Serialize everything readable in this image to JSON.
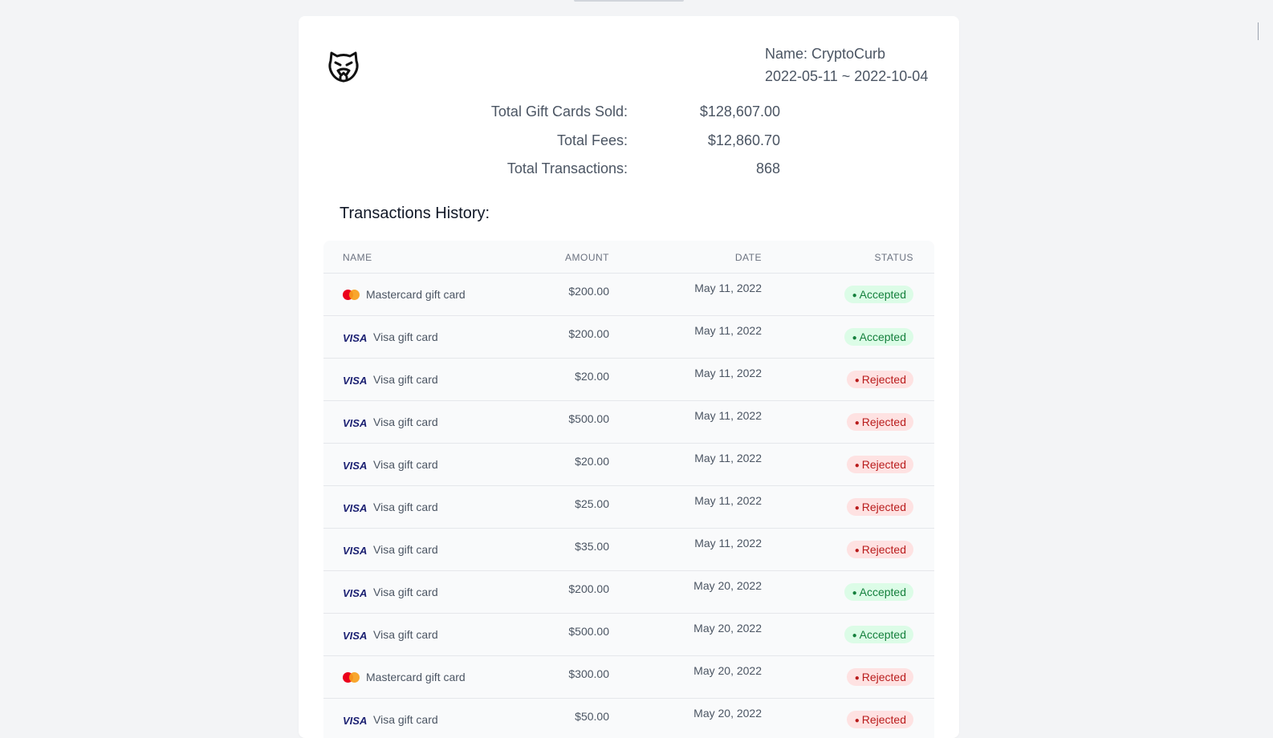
{
  "header": {
    "name_line": "Name: CryptoCurb",
    "date_range": "2022-05-11 ~ 2022-10-04"
  },
  "summary": [
    {
      "label": "Total Gift Cards Sold:",
      "value": "$128,607.00"
    },
    {
      "label": "Total Fees:",
      "value": "$12,860.70"
    },
    {
      "label": "Total Transactions:",
      "value": "868"
    }
  ],
  "history_title": "Transactions History:",
  "table": {
    "headers": {
      "name": "NAME",
      "amount": "AMOUNT",
      "date": "DATE",
      "status": "STATUS"
    },
    "rows": [
      {
        "brand": "mastercard",
        "brand_text": "",
        "name": "Mastercard gift card",
        "amount": "$200.00",
        "date": "May 11, 2022",
        "status": "Accepted"
      },
      {
        "brand": "visa",
        "brand_text": "VISA",
        "name": "Visa gift card",
        "amount": "$200.00",
        "date": "May 11, 2022",
        "status": "Accepted"
      },
      {
        "brand": "visa",
        "brand_text": "VISA",
        "name": "Visa gift card",
        "amount": "$20.00",
        "date": "May 11, 2022",
        "status": "Rejected"
      },
      {
        "brand": "visa",
        "brand_text": "VISA",
        "name": "Visa gift card",
        "amount": "$500.00",
        "date": "May 11, 2022",
        "status": "Rejected"
      },
      {
        "brand": "visa",
        "brand_text": "VISA",
        "name": "Visa gift card",
        "amount": "$20.00",
        "date": "May 11, 2022",
        "status": "Rejected"
      },
      {
        "brand": "visa",
        "brand_text": "VISA",
        "name": "Visa gift card",
        "amount": "$25.00",
        "date": "May 11, 2022",
        "status": "Rejected"
      },
      {
        "brand": "visa",
        "brand_text": "VISA",
        "name": "Visa gift card",
        "amount": "$35.00",
        "date": "May 11, 2022",
        "status": "Rejected"
      },
      {
        "brand": "visa",
        "brand_text": "VISA",
        "name": "Visa gift card",
        "amount": "$200.00",
        "date": "May 20, 2022",
        "status": "Accepted"
      },
      {
        "brand": "visa",
        "brand_text": "VISA",
        "name": "Visa gift card",
        "amount": "$500.00",
        "date": "May 20, 2022",
        "status": "Accepted"
      },
      {
        "brand": "mastercard",
        "brand_text": "",
        "name": "Mastercard gift card",
        "amount": "$300.00",
        "date": "May 20, 2022",
        "status": "Rejected"
      },
      {
        "brand": "visa",
        "brand_text": "VISA",
        "name": "Visa gift card",
        "amount": "$50.00",
        "date": "May 20, 2022",
        "status": "Rejected"
      }
    ]
  },
  "colors": {
    "accepted_bg": "#dcfce7",
    "accepted_text": "#15803d",
    "rejected_bg": "#fee2e2",
    "rejected_text": "#b91c1c",
    "mastercard_red": "#eb001b",
    "mastercard_orange": "#f79e1b",
    "visa_blue": "#1a1f71"
  },
  "icons": {
    "logo": "tiger-head-icon",
    "mastercard": "mastercard-logo-icon",
    "visa": "visa-logo-icon"
  }
}
